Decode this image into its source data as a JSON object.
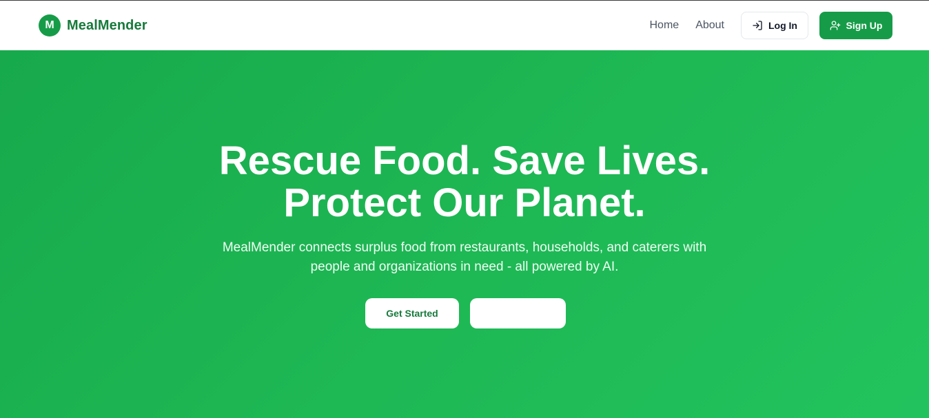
{
  "brand": {
    "badge_letter": "M",
    "name": "MealMender"
  },
  "nav": {
    "home_label": "Home",
    "about_label": "About",
    "login_label": "Log In",
    "signup_label": "Sign Up"
  },
  "hero": {
    "title_line1": "Rescue Food. Save Lives.",
    "title_line2": "Protect Our Planet.",
    "subtitle_line1": "MealMender connects surplus food from restaurants, households, and caterers with",
    "subtitle_line2": "people and organizations in need - all powered by AI.",
    "primary_cta": "Get Started",
    "secondary_cta": ""
  },
  "colors": {
    "brand_green": "#169c48",
    "hero_green_start": "#17a94c",
    "hero_green_end": "#22c35e"
  }
}
